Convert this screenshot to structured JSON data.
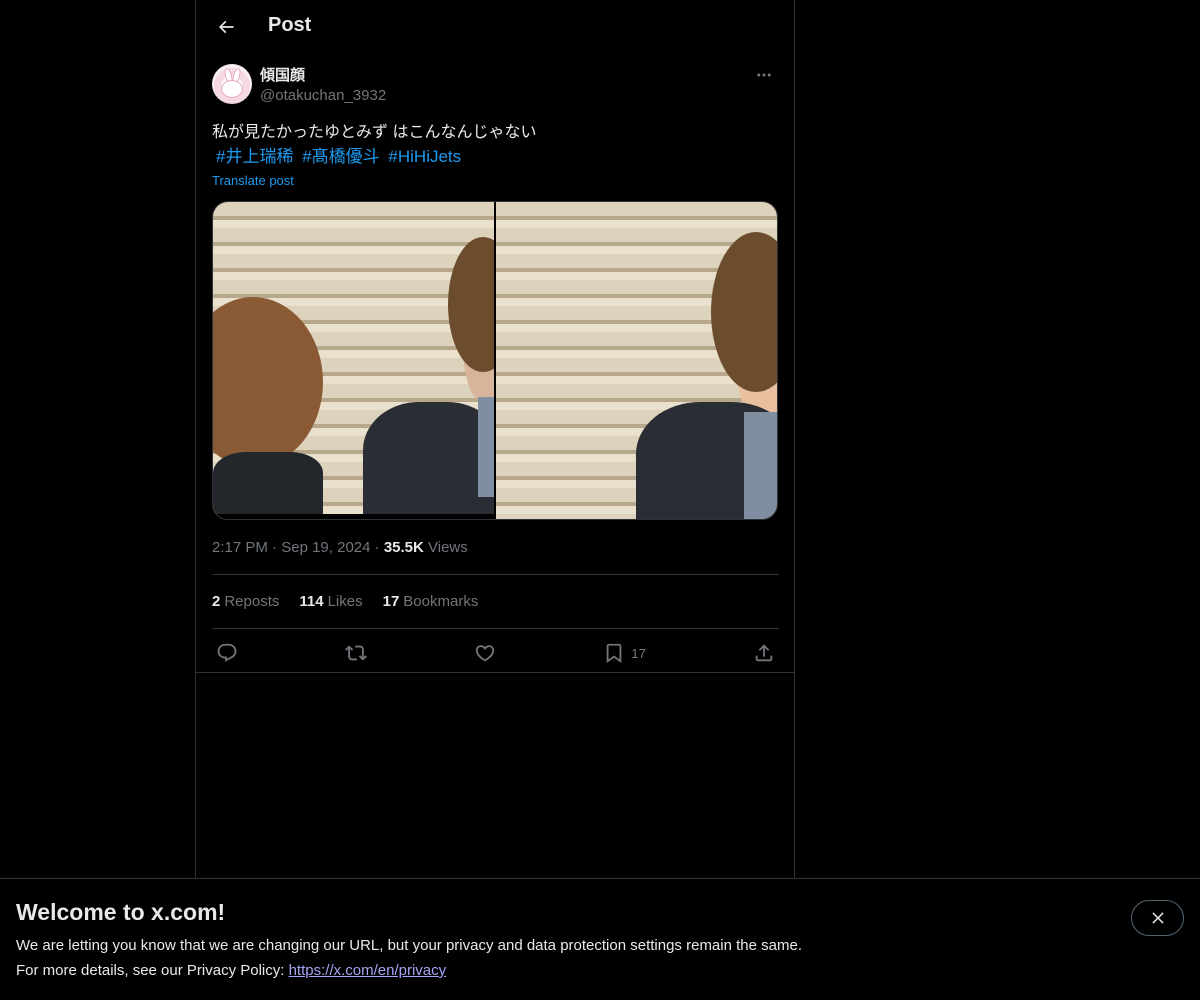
{
  "header": {
    "title": "Post"
  },
  "post": {
    "display_name": "傾国顔",
    "handle": "@otakuchan_3932",
    "text": "私が見たかったゆとみず はこんなんじゃない",
    "hashtags": [
      "#井上瑞稀",
      "#髙橋優斗",
      "#HiHiJets"
    ],
    "translate_label": "Translate post",
    "time": "2:17 PM",
    "date": "Sep 19, 2024",
    "separator": "·",
    "views_count": "35.5K",
    "views_label": "Views"
  },
  "stats": {
    "reposts_count": "2",
    "reposts_label": "Reposts",
    "likes_count": "114",
    "likes_label": "Likes",
    "bookmarks_count": "17",
    "bookmarks_label": "Bookmarks"
  },
  "actions": {
    "bookmark_count": "17",
    "icons": [
      "reply-icon",
      "repost-icon",
      "like-icon",
      "bookmark-icon",
      "share-icon"
    ]
  },
  "banner": {
    "title": "Welcome to x.com!",
    "line1": "We are letting you know that we are changing our URL, but your privacy and data protection settings remain the same.",
    "line2_prefix": "For more details, see our Privacy Policy: ",
    "link": "https://x.com/en/privacy"
  },
  "colors": {
    "accent": "#1d9bf0",
    "muted": "#71767b",
    "text": "#e7e9ea",
    "background": "#000000",
    "border": "#2f3336"
  }
}
